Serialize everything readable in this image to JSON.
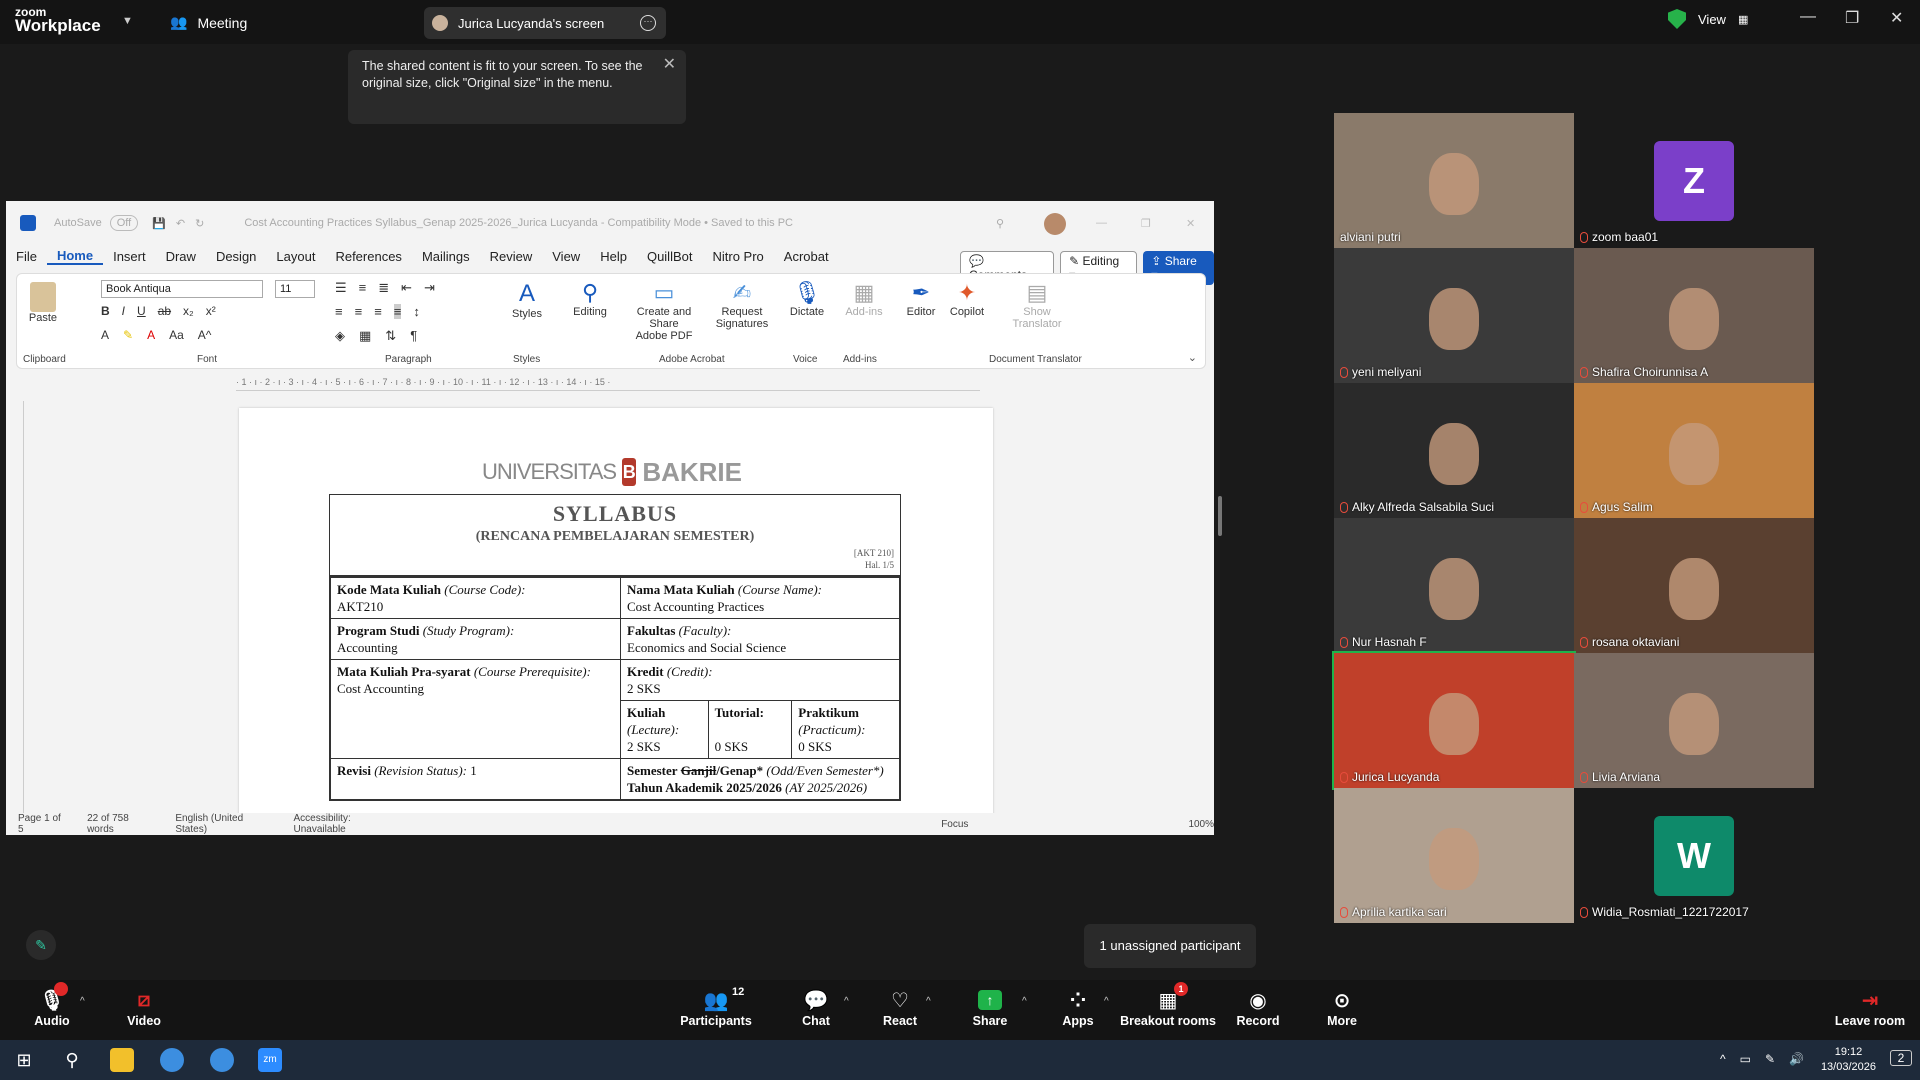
{
  "titlebar": {
    "logo_top": "zoom",
    "logo_bottom": "Workplace",
    "meeting": "Meeting",
    "share_tab": "Jurica Lucyanda's screen",
    "view": "View"
  },
  "tooltip": "The shared content is fit to your screen. To see the original size, click \"Original size\" in the menu.",
  "word": {
    "autosave": "AutoSave",
    "autosave_state": "Off",
    "title": "Cost Accounting Practices Syllabus_Genap 2025-2026_Jurica Lucyanda  -  Compatibility Mode  •  Saved to this PC",
    "menu": [
      "File",
      "Home",
      "Insert",
      "Draw",
      "Design",
      "Layout",
      "References",
      "Mailings",
      "Review",
      "View",
      "Help",
      "QuillBot",
      "Nitro Pro",
      "Acrobat"
    ],
    "comments": "Comments",
    "editing_mode": "Editing",
    "share": "Share",
    "font": "Book Antiqua",
    "font_size": "11",
    "ribbon": {
      "paste": "Paste",
      "clipboard": "Clipboard",
      "font_group": "Font",
      "paragraph": "Paragraph",
      "styles": "Styles",
      "styles_group": "Styles",
      "editing": "Editing",
      "create_share": "Create and Share",
      "adobe_pdf": "Adobe PDF",
      "request": "Request",
      "signatures": "Signatures",
      "adobe_acrobat": "Adobe Acrobat",
      "dictate": "Dictate",
      "voice": "Voice",
      "addins": "Add-ins",
      "addins_group": "Add-ins",
      "editor": "Editor",
      "copilot": "Copilot",
      "show": "Show",
      "translator": "Translator",
      "doc_translator": "Document Translator"
    },
    "ruler": "· 1 · ı · 2 · ı · 3 · ı · 4 · ı · 5 · ı · 6 · ı · 7 · ı · 8 · ı · 9 · ı · 10 · ı · 11 · ı · 12 · ı · 13 · ı · 14 · ı · 15 ·",
    "doc": {
      "logo_left": "UNIVERSITAS",
      "logo_mark": "B",
      "logo_right": "BAKRIE",
      "title": "SYLLABUS",
      "subtitle": "(RENCANA PEMBELAJARAN SEMESTER)",
      "code": "[AKT 210]",
      "page": "Hal. 1/5",
      "course_code_label": "Kode Mata Kuliah",
      "course_code_en": "(Course Code):",
      "course_code": "AKT210",
      "course_name_label": "Nama Mata Kuliah",
      "course_name_en": "(Course Name):",
      "course_name": "Cost Accounting Practices",
      "program_label": "Program Studi",
      "program_en": "(Study Program):",
      "program": "Accounting",
      "faculty_label": "Fakultas",
      "faculty_en": "(Faculty):",
      "faculty": "Economics and Social Science",
      "prereq_label": "Mata Kuliah Pra-syarat",
      "prereq_en": "(Course Prerequisite):",
      "prereq": "Cost Accounting",
      "credit_label": "Kredit",
      "credit_en": "(Credit):",
      "credit": "2 SKS",
      "lecture_label": "Kuliah",
      "lecture_en": "(Lecture):",
      "lecture": "2 SKS",
      "tutorial_label": "Tutorial:",
      "tutorial": "0 SKS",
      "practicum_label": "Praktikum",
      "practicum_en": "(Practicum):",
      "practicum": "0 SKS",
      "revision_label": "Revisi",
      "revision_en": "(Revision Status):",
      "revision": "1",
      "semester_label": "Semester",
      "semester_ganjil": "Ganjil",
      "semester_genap": "/Genap*",
      "semester_en": "(Odd/Even Semester*)",
      "ay_label": "Tahun Akademik 2025/2026",
      "ay_en": "(AY 2025/2026)"
    },
    "status": {
      "page": "Page 1 of 5",
      "words": "22 of 758 words",
      "lang": "English (United States)",
      "access": "Accessibility: Unavailable",
      "focus": "Focus",
      "zoom": "100%"
    }
  },
  "participants": [
    {
      "name": "alviani putri"
    },
    {
      "name": "zoom baa01",
      "letter": "Z"
    },
    {
      "name": "yeni meliyani"
    },
    {
      "name": "Shafira Choirunnisa A"
    },
    {
      "name": "Alky Alfreda Salsabila Suci"
    },
    {
      "name": "Agus Salim"
    },
    {
      "name": "Nur Hasnah F"
    },
    {
      "name": "rosana oktaviani"
    },
    {
      "name": "Jurica Lucyanda"
    },
    {
      "name": "Livia Arviana"
    },
    {
      "name": "Aprilia kartika sari"
    },
    {
      "name": "Widia_Rosmiati_1221722017",
      "letter": "W"
    }
  ],
  "unassigned": "1 unassigned participant",
  "toolbar": {
    "audio": "Audio",
    "video": "Video",
    "participants": "Participants",
    "participants_count": "12",
    "chat": "Chat",
    "react": "React",
    "share": "Share",
    "apps": "Apps",
    "breakout": "Breakout rooms",
    "breakout_badge": "1",
    "record": "Record",
    "more": "More",
    "leave": "Leave room"
  },
  "taskbar": {
    "time": "19:12",
    "date": "13/03/2026",
    "notif": "2"
  },
  "colors": {
    "zoom_bg": "#1a1a1a",
    "word_blue": "#185abd",
    "share_green": "#1fb34a",
    "leave_red": "#e02828"
  }
}
